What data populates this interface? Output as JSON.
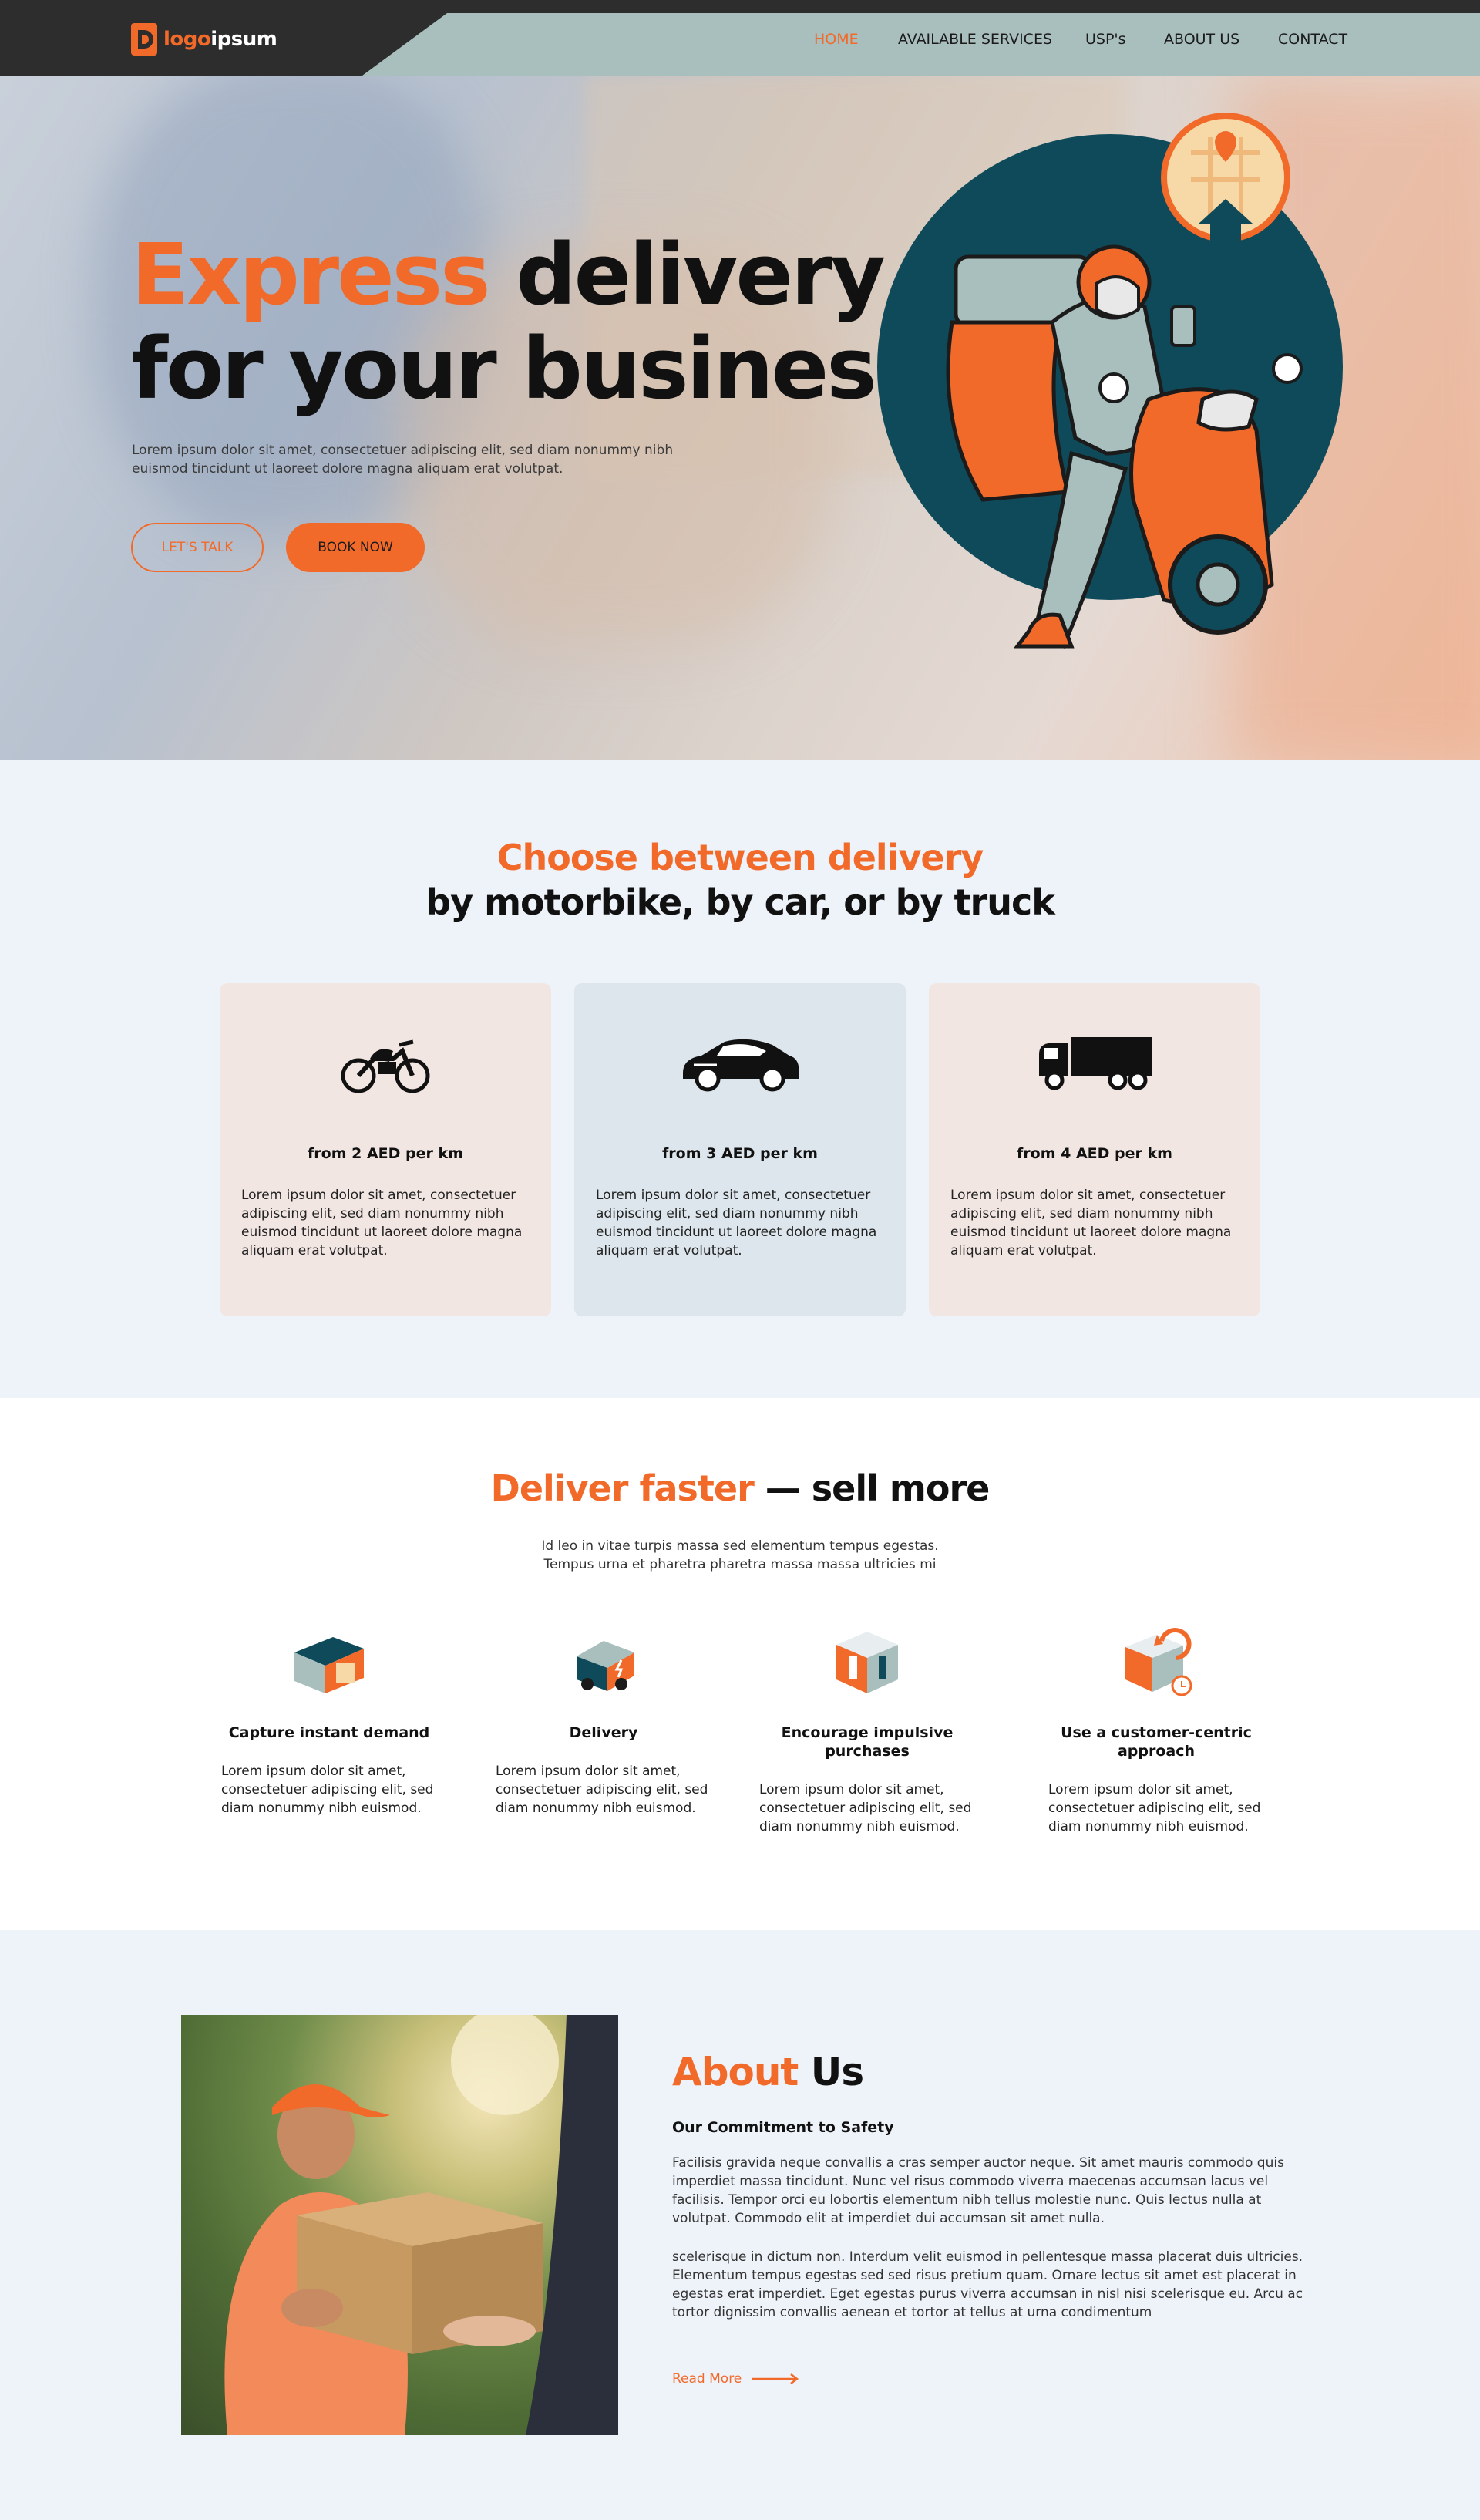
{
  "brand": {
    "logo_text_a": "logo",
    "logo_text_b": "ipsum",
    "accent_color": "#f26a2a"
  },
  "nav": {
    "items": [
      {
        "label": "HOME",
        "active": true
      },
      {
        "label": "AVAILABLE SERVICES",
        "active": false
      },
      {
        "label": "USP's",
        "active": false
      },
      {
        "label": "ABOUT US",
        "active": false
      },
      {
        "label": "CONTACT",
        "active": false
      }
    ]
  },
  "hero": {
    "title_accent": "Express",
    "title_rest_1": "delivery",
    "title_line_2": "for your business",
    "description": "Lorem ipsum dolor sit amet, consectetuer adipiscing elit, sed diam nonummy nibh euismod tincidunt ut laoreet dolore magna aliquam erat volutpat.",
    "btn_talk": "LET'S TALK",
    "btn_book": "BOOK NOW"
  },
  "choose": {
    "title_accent": "Choose between delivery",
    "title_rest": "by motorbike, by car, or by truck",
    "cards": [
      {
        "icon": "motorbike-icon",
        "price": "from 2 AED per km",
        "desc": "Lorem ipsum dolor sit amet, consectetuer adipiscing elit, sed diam nonummy nibh euismod tincidunt ut laoreet dolore magna aliquam erat volutpat.",
        "bg": "#f2e6e3"
      },
      {
        "icon": "car-icon",
        "price": "from 3 AED per km",
        "desc": "Lorem ipsum dolor sit amet, consectetuer adipiscing elit, sed diam nonummy nibh euismod tincidunt ut laoreet dolore magna aliquam erat volutpat.",
        "bg": "#dde6ec"
      },
      {
        "icon": "truck-icon",
        "price": "from 4 AED per km",
        "desc": "Lorem ipsum dolor sit amet, consectetuer adipiscing elit, sed diam nonummy nibh euismod tincidunt ut laoreet dolore magna aliquam erat volutpat.",
        "bg": "#f2e6e3"
      }
    ]
  },
  "faster": {
    "title_accent": "Deliver faster",
    "title_rest": " — sell more",
    "sub_line_1": "Id leo in vitae turpis massa sed elementum tempus egestas.",
    "sub_line_2": "Tempus urna et pharetra pharetra massa massa ultricies mi",
    "features": [
      {
        "icon": "storefront-icon",
        "title": "Capture instant demand",
        "desc": "Lorem ipsum dolor sit amet, consectetuer adipiscing elit, sed diam nonummy nibh euismod."
      },
      {
        "icon": "delivery-van-icon",
        "title": "Delivery",
        "desc": "Lorem ipsum dolor sit amet, consectetuer adipiscing elit, sed diam nonummy nibh euismod."
      },
      {
        "icon": "package-box-icon",
        "title": "Encourage impulsive purchases",
        "desc": "Lorem ipsum dolor sit amet, consectetuer adipiscing elit, sed diam nonummy nibh euismod."
      },
      {
        "icon": "return-box-icon",
        "title": "Use a customer-centric approach",
        "desc": "Lorem ipsum dolor sit amet, consectetuer adipiscing elit, sed diam nonummy nibh euismod."
      }
    ]
  },
  "about": {
    "title_accent": "About",
    "title_rest": "Us",
    "subtitle": "Our Commitment to Safety",
    "p1": "Facilisis gravida neque convallis a cras semper auctor neque. Sit amet mauris commodo quis imperdiet massa tincidunt. Nunc vel risus commodo viverra maecenas accumsan lacus vel facilisis. Tempor orci eu lobortis elementum nibh tellus molestie nunc. Quis lectus nulla at volutpat. Commodo elit at imperdiet dui accumsan sit amet nulla.",
    "p2": "scelerisque in dictum non. Interdum velit euismod in pellentesque massa placerat duis ultricies. Elementum tempus egestas sed sed risus pretium quam. Ornare lectus sit amet est placerat in egestas erat imperdiet. Eget egestas purus viverra accumsan in nisl nisi scelerisque eu. Arcu ac tortor dignissim convallis aenean et tortor at tellus at urna condimentum",
    "read_more": "Read More"
  }
}
